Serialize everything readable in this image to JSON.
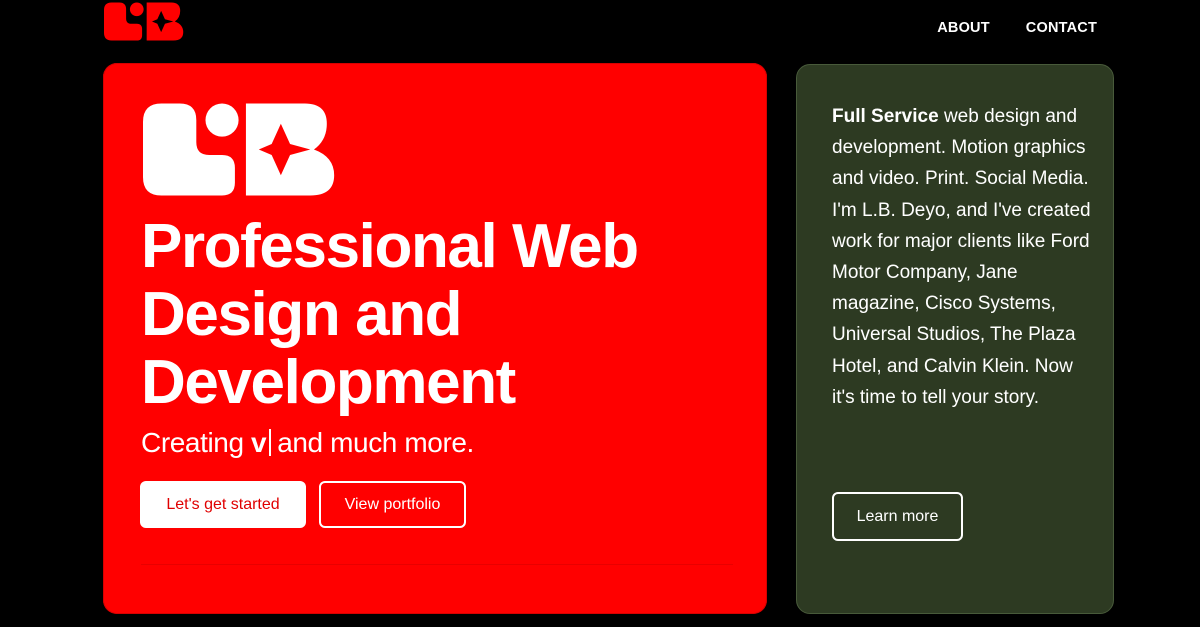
{
  "brand": {
    "logo_alt": "L.B. Deyo logo",
    "logo_color": "#ff0000",
    "logo_inverse_color": "#ffffff"
  },
  "nav": {
    "items": [
      {
        "label": "ABOUT"
      },
      {
        "label": "CONTACT"
      }
    ]
  },
  "hero": {
    "background": "#ff0000",
    "title": "Professional Web Design and Development",
    "subtitle_prefix": "Creating ",
    "subtitle_typed": "v",
    "subtitle_suffix": "and much more.",
    "primary_button": "Let's get started",
    "secondary_button": "View portfolio"
  },
  "side": {
    "background": "#2d3a22",
    "bold_lead": "Full Service",
    "body": " web design and development. Motion graphics and video. Print. Social Media. I'm L.B. Deyo, and I've created work for major clients like Ford Motor Company, Jane magazine, Cisco Systems, Universal Studios, The Plaza Hotel, and Calvin Klein. Now it's time to tell your story.",
    "button": "Learn more"
  },
  "icons": {
    "logo": "lb-logo-icon",
    "typing_cursor": "text-cursor-icon"
  }
}
